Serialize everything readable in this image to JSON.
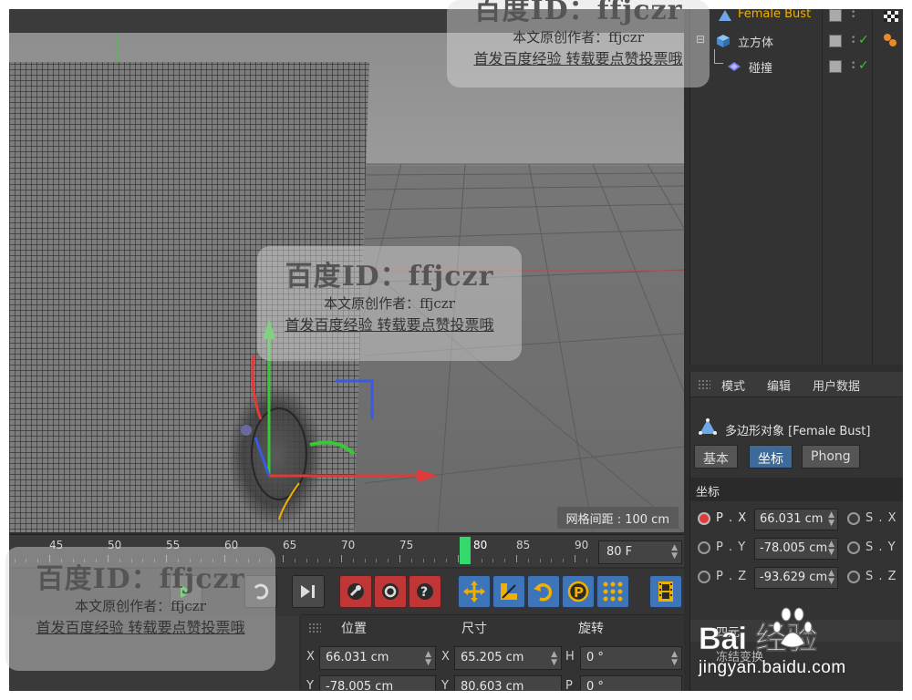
{
  "objects": [
    {
      "name": "Female Bust",
      "selected": true
    },
    {
      "name": "立方体",
      "selected": false
    },
    {
      "name": "碰撞",
      "selected": false
    }
  ],
  "viewport": {
    "grid_spacing": "网格间距 : 100 cm"
  },
  "attributes": {
    "menu": [
      "模式",
      "编辑",
      "用户数据"
    ],
    "object_title": "多边形对象 [Female Bust]",
    "tabs": [
      "基本",
      "坐标",
      "Phong"
    ],
    "active_tab": "坐标",
    "section": "坐标",
    "rows": [
      {
        "p_label": "P . X",
        "p_value": "66.031 cm",
        "s_label": "S . X"
      },
      {
        "p_label": "P . Y",
        "p_value": "-78.005 cm",
        "s_label": "S . Y"
      },
      {
        "p_label": "P . Z",
        "p_value": "-93.629 cm",
        "s_label": "S . Z"
      }
    ],
    "quaternion": "四元",
    "freeze": "冻结变换"
  },
  "timeline": {
    "ticks": [
      "45",
      "50",
      "55",
      "60",
      "65",
      "70",
      "75",
      "80",
      "85",
      "90"
    ],
    "current_frame": "80",
    "frame_field": "80 F"
  },
  "coordinates": {
    "headers": [
      "位置",
      "尺寸",
      "旋转"
    ],
    "rows": [
      {
        "axis": "X",
        "pos": "66.031 cm",
        "size_axis": "X",
        "size": "65.205 cm",
        "rot_axis": "H",
        "rot": "0 °"
      },
      {
        "axis": "Y",
        "pos": "-78.005 cm",
        "size_axis": "Y",
        "size": "80.603 cm",
        "rot_axis": "P",
        "rot": "0 °"
      }
    ]
  },
  "watermark": {
    "title": "百度ID：ffjczr",
    "line1": "本文原创作者：ffjczr",
    "line2": "首发百度经验 转载要点赞投票哦"
  },
  "logo": {
    "text": "Bai 经验",
    "url": "jingyan.baidu.com"
  },
  "colors": {
    "selected_object": "#f0b000",
    "active_tab": "#3e6a9a",
    "playhead": "#33d96a",
    "axis_x": "#e03a3a",
    "axis_y": "#38c838",
    "axis_z": "#3a5ae0"
  }
}
